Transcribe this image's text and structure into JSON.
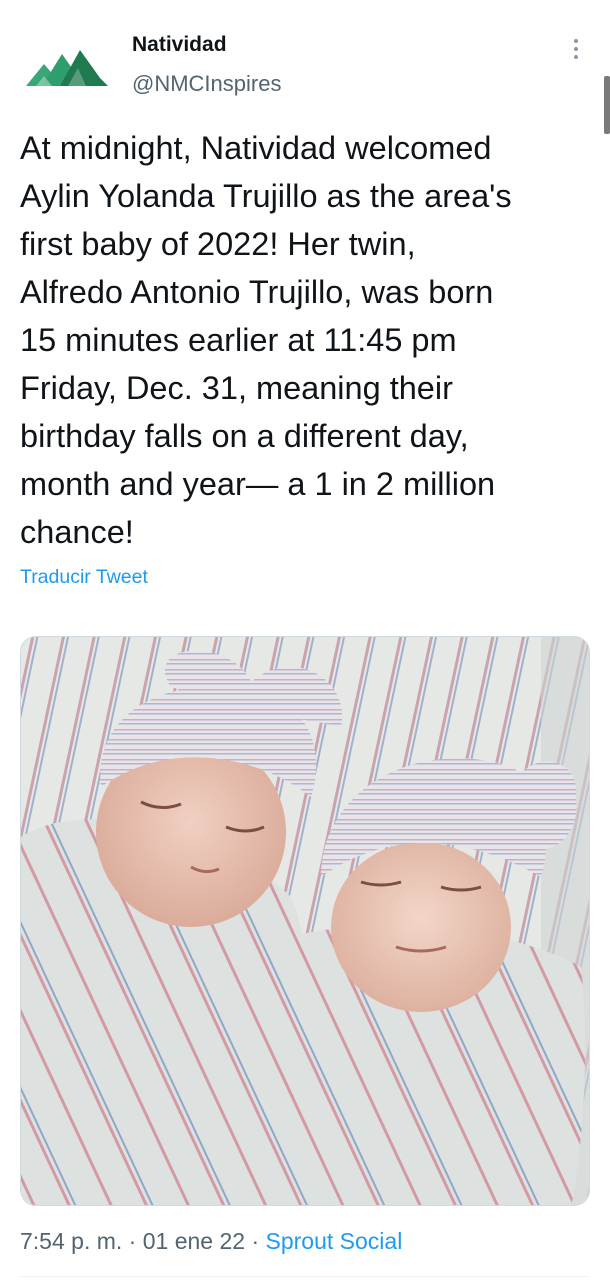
{
  "author": {
    "name": "Natividad",
    "handle": "@NMCInspires",
    "logo_colors": [
      "#2f9e6e",
      "#1f7a4f",
      "#46b98a"
    ]
  },
  "tweet": {
    "lines": [
      "At midnight, Natividad welcomed",
      "Aylin Yolanda Trujillo as the area's",
      "first baby of 2022! Her twin,",
      "Alfredo Antonio Trujillo, was born",
      "15 minutes earlier at 11:45 pm",
      "Friday, Dec. 31, meaning their",
      "birthday falls on a different day,",
      "month and year— a 1 in 2 million",
      "chance!"
    ],
    "translate_label": "Traducir Tweet"
  },
  "media": {
    "icon": "photo-of-newborn-twins"
  },
  "meta": {
    "time": "7:54 p. m.",
    "sep1": " · ",
    "date": "01 ene 22",
    "sep2": " · ",
    "source": "Sprout Social"
  },
  "colors": {
    "accent": "#1d9bf0",
    "secondary_text": "#536471"
  },
  "icons": {
    "more": "more-vertical-icon",
    "logo": "natividad-logo-icon"
  }
}
